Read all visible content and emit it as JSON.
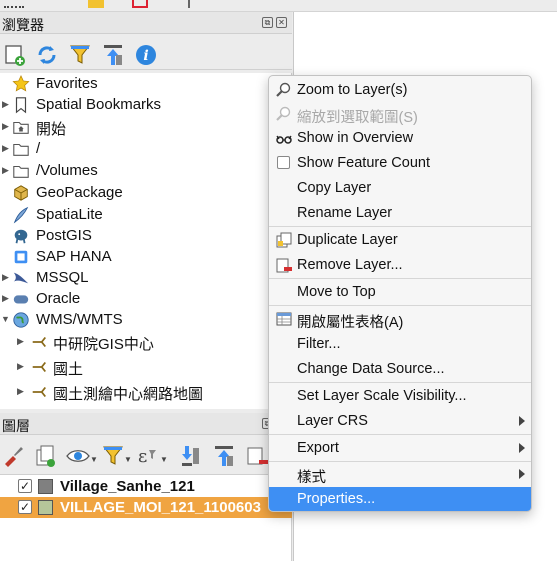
{
  "browser_panel": {
    "title": "瀏覽器",
    "items": [
      {
        "label": "Favorites",
        "icon": "star-icon"
      },
      {
        "label": "Spatial Bookmarks",
        "icon": "bookmark-icon"
      },
      {
        "label": "開始",
        "icon": "home-folder-icon"
      },
      {
        "label": "/",
        "icon": "folder-icon"
      },
      {
        "label": "/Volumes",
        "icon": "folder-icon"
      },
      {
        "label": "GeoPackage",
        "icon": "geopackage-icon"
      },
      {
        "label": "SpatiaLite",
        "icon": "spatialite-icon"
      },
      {
        "label": "PostGIS",
        "icon": "postgis-icon"
      },
      {
        "label": "SAP HANA",
        "icon": "database-icon"
      },
      {
        "label": "MSSQL",
        "icon": "mssql-icon"
      },
      {
        "label": "Oracle",
        "icon": "oracle-icon"
      },
      {
        "label": "WMS/WMTS",
        "icon": "globe-icon"
      },
      {
        "label": "中研院GIS中心",
        "icon": "wms-layer-icon"
      },
      {
        "label": "國土",
        "icon": "wms-layer-icon"
      },
      {
        "label": "國土測繪中心網路地圖",
        "icon": "wms-layer-icon"
      }
    ]
  },
  "layers_panel": {
    "title": "圖層",
    "layers": [
      {
        "name": "Village_Sanhe_121",
        "checked": true,
        "color": "#808080"
      },
      {
        "name": "VILLAGE_MOI_121_1100603",
        "checked": true,
        "color": "#b5c69a"
      }
    ]
  },
  "context_menu": {
    "items": [
      {
        "label": "Zoom to Layer(s)",
        "icon": "zoom-layer-icon"
      },
      {
        "label": "縮放到選取範圍(S)",
        "icon": "zoom-selection-icon",
        "disabled": true
      },
      {
        "label": "Show in Overview",
        "icon": "glasses-icon"
      },
      {
        "label": "Show Feature Count",
        "icon": "checkbox-icon"
      },
      {
        "label": "Copy Layer",
        "icon": ""
      },
      {
        "label": "Rename Layer",
        "icon": ""
      },
      {
        "label": "Duplicate Layer",
        "icon": "duplicate-layer-icon"
      },
      {
        "label": "Remove Layer...",
        "icon": "remove-layer-icon"
      },
      {
        "label": "Move to Top",
        "icon": ""
      },
      {
        "label": "開啟屬性表格(A)",
        "icon": "attribute-table-icon"
      },
      {
        "label": "Filter...",
        "icon": ""
      },
      {
        "label": "Change Data Source...",
        "icon": ""
      },
      {
        "label": "Set Layer Scale Visibility...",
        "icon": ""
      },
      {
        "label": "Layer CRS",
        "icon": "",
        "submenu": true
      },
      {
        "label": "Export",
        "icon": "",
        "submenu": true
      },
      {
        "label": "樣式",
        "icon": "",
        "submenu": true
      },
      {
        "label": "Properties...",
        "icon": "",
        "highlighted": true
      }
    ]
  },
  "colors": {
    "selection": "#f0a441",
    "menu_highlight": "#3e8ff3"
  }
}
